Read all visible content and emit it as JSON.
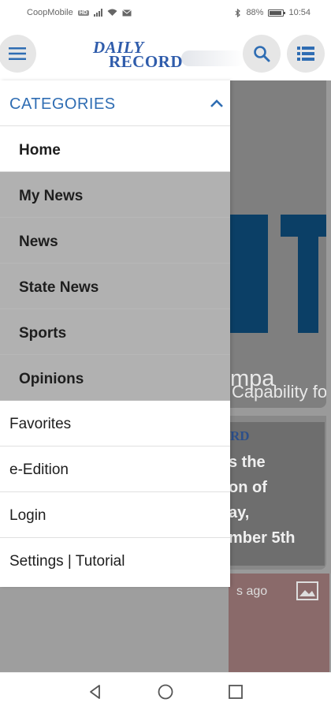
{
  "status_bar": {
    "carrier": "CoopMobile",
    "carrier_badge": "HD",
    "battery": "88%",
    "time": "10:54"
  },
  "app_bar": {
    "logo_line1": "DAILY",
    "logo_line2": "RECORD",
    "menu_icon": "hamburger-icon",
    "search_icon": "search-icon",
    "list_icon": "list-icon"
  },
  "drawer": {
    "categories_title": "CATEGORIES",
    "categories": [
      {
        "label": "Home"
      },
      {
        "label": "My News"
      },
      {
        "label": "News"
      },
      {
        "label": "State News"
      },
      {
        "label": "Sports"
      },
      {
        "label": "Opinions"
      }
    ],
    "items": [
      {
        "label": "Favorites"
      },
      {
        "label": "e-Edition"
      },
      {
        "label": "Login"
      },
      {
        "label": "Settings | Tutorial"
      }
    ]
  },
  "background": {
    "card1_title": "mpa",
    "card1_subtitle": "Capability for th...",
    "card2_logo": "RD",
    "card2_lines": [
      "s the",
      "on of",
      "ay,",
      "mber 5th"
    ],
    "row3_meta": "s ago"
  },
  "colors": {
    "accent": "#2f6db3",
    "logo": "#2f5cab"
  }
}
